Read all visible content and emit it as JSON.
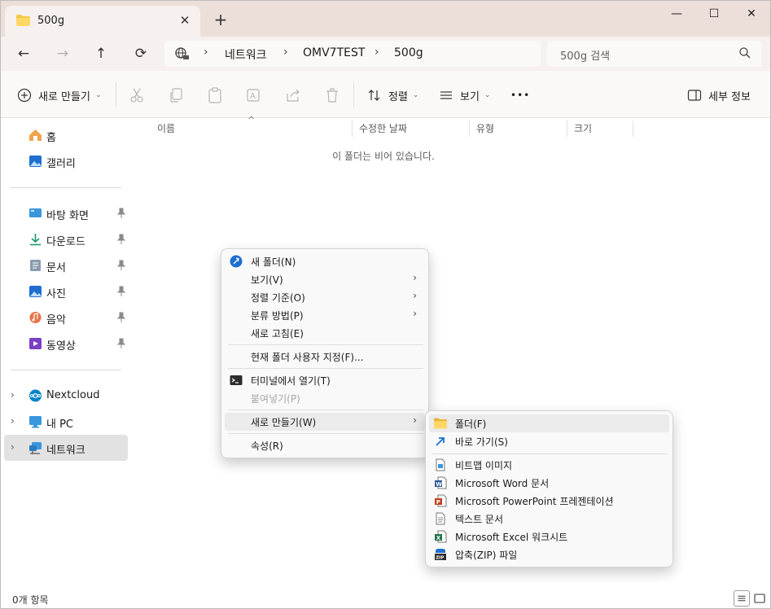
{
  "tab": {
    "title": "500g",
    "close": "✕",
    "new_tab": "+"
  },
  "window_controls": {
    "minimize": "—",
    "maximize": "☐",
    "close": "✕"
  },
  "nav": {
    "back": "←",
    "forward": "→",
    "up": "↑",
    "refresh": "⟳"
  },
  "breadcrumb": {
    "items": [
      "네트워크",
      "OMV7TEST",
      "500g"
    ],
    "separator": "›"
  },
  "search": {
    "placeholder": "500g 검색"
  },
  "toolbar": {
    "new_label": "새로 만들기",
    "sort_label": "정렬",
    "view_label": "보기",
    "more": "•••",
    "details_label": "세부 정보"
  },
  "sidebar": {
    "items": [
      {
        "label": "홈",
        "icon": "home-icon"
      },
      {
        "label": "갤러리",
        "icon": "gallery-icon"
      },
      {
        "label": "바탕 화면",
        "icon": "desktop-icon",
        "pinned": true
      },
      {
        "label": "다운로드",
        "icon": "download-icon",
        "pinned": true
      },
      {
        "label": "문서",
        "icon": "document-icon",
        "pinned": true
      },
      {
        "label": "사진",
        "icon": "pictures-icon",
        "pinned": true
      },
      {
        "label": "음악",
        "icon": "music-icon",
        "pinned": true
      },
      {
        "label": "동영상",
        "icon": "video-icon",
        "pinned": true
      },
      {
        "label": "Nextcloud",
        "icon": "nextcloud-icon"
      },
      {
        "label": "내 PC",
        "icon": "pc-icon"
      },
      {
        "label": "네트워크",
        "icon": "network-icon",
        "selected": true
      }
    ]
  },
  "columns": [
    "이름",
    "수정한 날짜",
    "유형",
    "크기"
  ],
  "empty_message": "이 폴더는 비어 있습니다.",
  "status": {
    "item_count": "0개 항목"
  },
  "context_menu": {
    "items": [
      {
        "label": "새 폴더(N)",
        "icon": "new-folder-icon"
      },
      {
        "label": "보기(V)",
        "submenu": true
      },
      {
        "label": "정렬 기준(O)",
        "submenu": true
      },
      {
        "label": "분류 방법(P)",
        "submenu": true
      },
      {
        "label": "새로 고침(E)"
      },
      {
        "label": "현재 폴더 사용자 지정(F)..."
      },
      {
        "label": "터미널에서 열기(T)",
        "icon": "terminal-icon"
      },
      {
        "label": "붙여넣기(P)",
        "disabled": true
      },
      {
        "label": "새로 만들기(W)",
        "submenu": true,
        "highlighted": true
      },
      {
        "label": "속성(R)"
      }
    ],
    "submenu_arrow": "›"
  },
  "new_submenu": {
    "items": [
      {
        "label": "폴더(F)",
        "icon": "folder-icon"
      },
      {
        "label": "바로 가기(S)",
        "icon": "shortcut-icon"
      },
      {
        "label": "비트맵 이미지",
        "icon": "bitmap-icon"
      },
      {
        "label": "Microsoft Word 문서",
        "icon": "word-icon"
      },
      {
        "label": "Microsoft PowerPoint 프레젠테이션",
        "icon": "powerpoint-icon"
      },
      {
        "label": "텍스트 문서",
        "icon": "text-document-icon"
      },
      {
        "label": "Microsoft Excel 워크시트",
        "icon": "excel-icon"
      },
      {
        "label": "압축(ZIP) 파일",
        "icon": "zip-icon"
      }
    ]
  },
  "colors": {
    "titlebar": "#ecdfda",
    "accent_blue": "#1e6fcf",
    "folder_yellow": "#f5c945",
    "word": "#2b5797",
    "powerpoint": "#c43e1c",
    "excel": "#1e7145"
  }
}
